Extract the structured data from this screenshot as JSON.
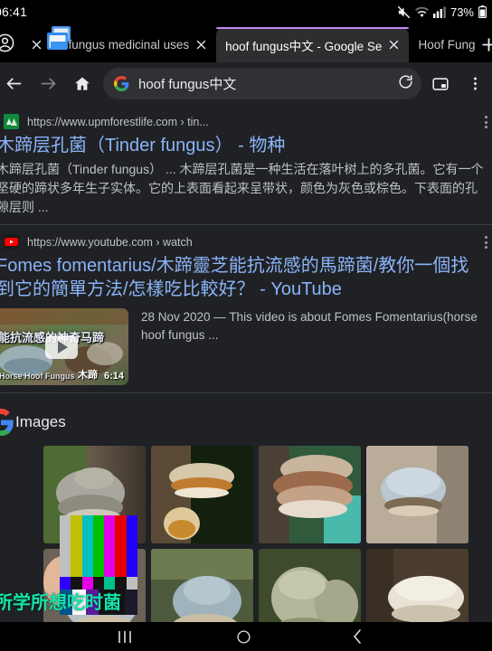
{
  "status_bar": {
    "time": "06:41",
    "battery": "73%",
    "icons": [
      "mute-icon",
      "wifi-icon",
      "signal-icon",
      "battery-icon"
    ]
  },
  "tabs": {
    "account_icon": "account-circle-icon",
    "new_tab_label": "+",
    "items": [
      {
        "title": "oof fungus medicinal uses",
        "active": false
      },
      {
        "title": "hoof fungus中文 - Google Se",
        "active": true
      },
      {
        "title": "Hoof Fung",
        "active": false
      }
    ]
  },
  "toolbar": {
    "back_icon": "arrow-back-icon",
    "forward_icon": "arrow-forward-icon",
    "home_icon": "home-icon",
    "reload_icon": "reload-icon",
    "tab_count_icon": "tab-switcher-icon",
    "menu_icon": "overflow-menu-icon",
    "url_value": "hoof fungus中文",
    "url_placeholder": "Search or type web address",
    "search_engine_icon": "google-g-icon"
  },
  "results": [
    {
      "url": "https://www.upmforestlife.com › tin...",
      "favicon": "upm-forest-life-favicon",
      "title": "木蹄层孔菌（Tinder fungus） - 物种",
      "snippet": "木蹄层孔菌（Tinder fungus） ... 木蹄层孔菌是一种生活在落叶树上的多孔菌。它有一个坚硬的蹄状多年生子实体。它的上表面看起来呈带状，颜色为灰色或棕色。下表面的孔隙层则 ..."
    },
    {
      "url": "https://www.youtube.com › watch",
      "favicon": "youtube-favicon",
      "title": "Fomes fomentarius/木蹄靈芝能抗流感的馬蹄菌/教你一個找到它的簡單方法/怎樣吃比較好？ - YouTube",
      "meta": "28 Nov 2020 — This video is about Fomes Fomentarius(horse hoof fungus ...",
      "thumbnail": {
        "caption": "能抗流感的神奇马蹄",
        "brand": "Horse Hoof Fungus",
        "cn_label": "木蹄",
        "duration": "6:14",
        "play_icon": "play-button-icon"
      }
    }
  ],
  "images_section": {
    "label": "Images",
    "logo_icon": "google-g-icon",
    "tiles": [
      {
        "alt": "bracket-fungus-grey-on-bark"
      },
      {
        "alt": "tinder-fungus-tan-underside"
      },
      {
        "alt": "banded-brown-bracket-fungus"
      },
      {
        "alt": "pale-blue-grey-hoof-fungus"
      },
      {
        "alt": "hoof-fungus-in-hand"
      },
      {
        "alt": "blue-grey-bracket-on-moss"
      },
      {
        "alt": "pale-green-layered-bracket"
      },
      {
        "alt": "white-hoof-fungus-on-trunk"
      }
    ]
  },
  "overlay": {
    "color_bars_name": "smpte-color-bars",
    "row1_colors": [
      "#c0c0c0",
      "#c0c000",
      "#00c0c0",
      "#00c000",
      "#e400e4",
      "#e40000",
      "#2000ff"
    ],
    "row2_colors": [
      "#3000ff",
      "#131313",
      "#e400e4",
      "#131313",
      "#00c08c",
      "#131313",
      "#c0c0c0"
    ],
    "row3_colors": [
      "#00558c",
      "#fdf8ff",
      "#5a1a9b",
      "#131313",
      "#131313",
      "#1a1a2a"
    ],
    "green_text": "所学所想吃时菌"
  },
  "nav_bar": {
    "recents_icon": "recents-icon",
    "home_icon": "home-circle-icon",
    "back_icon": "back-chevron-icon"
  }
}
